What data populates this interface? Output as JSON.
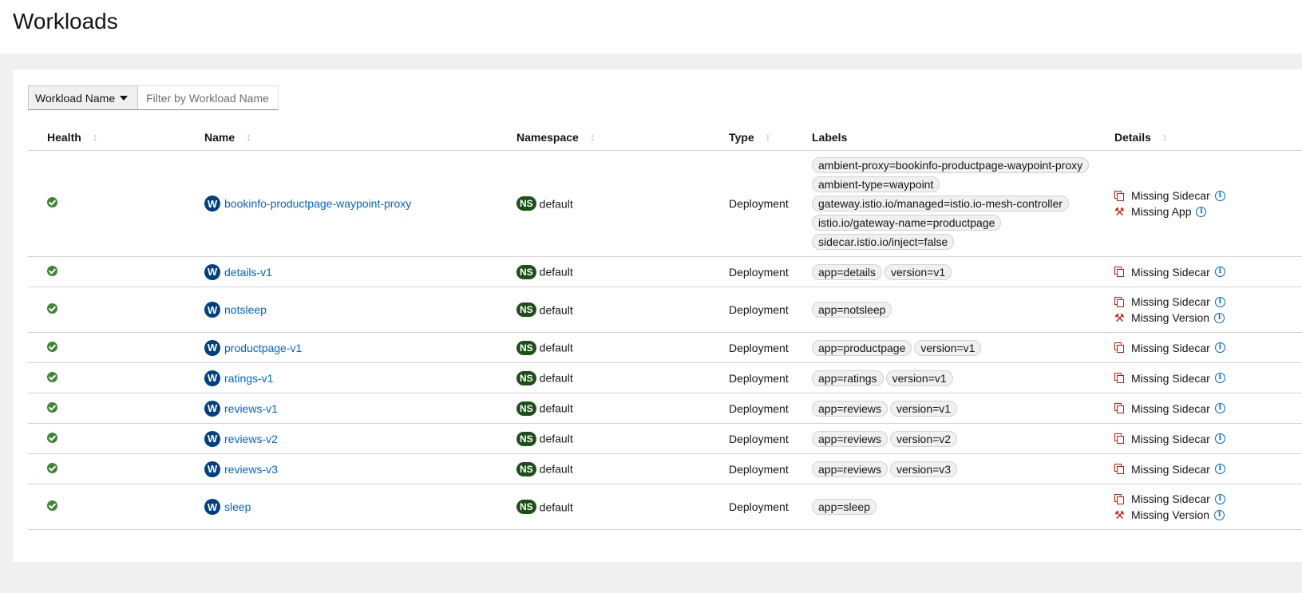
{
  "page": {
    "title": "Workloads"
  },
  "filter": {
    "select_label": "Workload Name",
    "placeholder": "Filter by Workload Name"
  },
  "columns": {
    "health": "Health",
    "name": "Name",
    "namespace": "Namespace",
    "type": "Type",
    "labels": "Labels",
    "details": "Details"
  },
  "colors": {
    "link": "#0066cc",
    "health_ok": "#3e8635",
    "workload_badge": "#004080",
    "namespace_badge": "#1e4f18",
    "warning": "#c9190b"
  },
  "badges": {
    "workload": "W",
    "namespace": "NS"
  },
  "rows": [
    {
      "health": "healthy",
      "name": "bookinfo-productpage-waypoint-proxy",
      "namespace": "default",
      "type": "Deployment",
      "labels": [
        "ambient-proxy=bookinfo-productpage-waypoint-proxy",
        "ambient-type=waypoint",
        "gateway.istio.io/managed=istio.io-mesh-controller",
        "istio.io/gateway-name=productpage",
        "sidecar.istio.io/inject=false"
      ],
      "details": [
        {
          "icon": "sidecar-icon",
          "text": "Missing Sidecar"
        },
        {
          "icon": "wrench-icon",
          "text": "Missing App"
        }
      ]
    },
    {
      "health": "healthy",
      "name": "details-v1",
      "namespace": "default",
      "type": "Deployment",
      "labels": [
        "app=details",
        "version=v1"
      ],
      "details": [
        {
          "icon": "sidecar-icon",
          "text": "Missing Sidecar"
        }
      ]
    },
    {
      "health": "healthy",
      "name": "notsleep",
      "namespace": "default",
      "type": "Deployment",
      "labels": [
        "app=notsleep"
      ],
      "details": [
        {
          "icon": "sidecar-icon",
          "text": "Missing Sidecar"
        },
        {
          "icon": "wrench-icon",
          "text": "Missing Version"
        }
      ]
    },
    {
      "health": "healthy",
      "name": "productpage-v1",
      "namespace": "default",
      "type": "Deployment",
      "labels": [
        "app=productpage",
        "version=v1"
      ],
      "details": [
        {
          "icon": "sidecar-icon",
          "text": "Missing Sidecar"
        }
      ]
    },
    {
      "health": "healthy",
      "name": "ratings-v1",
      "namespace": "default",
      "type": "Deployment",
      "labels": [
        "app=ratings",
        "version=v1"
      ],
      "details": [
        {
          "icon": "sidecar-icon",
          "text": "Missing Sidecar"
        }
      ]
    },
    {
      "health": "healthy",
      "name": "reviews-v1",
      "namespace": "default",
      "type": "Deployment",
      "labels": [
        "app=reviews",
        "version=v1"
      ],
      "details": [
        {
          "icon": "sidecar-icon",
          "text": "Missing Sidecar"
        }
      ]
    },
    {
      "health": "healthy",
      "name": "reviews-v2",
      "namespace": "default",
      "type": "Deployment",
      "labels": [
        "app=reviews",
        "version=v2"
      ],
      "details": [
        {
          "icon": "sidecar-icon",
          "text": "Missing Sidecar"
        }
      ]
    },
    {
      "health": "healthy",
      "name": "reviews-v3",
      "namespace": "default",
      "type": "Deployment",
      "labels": [
        "app=reviews",
        "version=v3"
      ],
      "details": [
        {
          "icon": "sidecar-icon",
          "text": "Missing Sidecar"
        }
      ]
    },
    {
      "health": "healthy",
      "name": "sleep",
      "namespace": "default",
      "type": "Deployment",
      "labels": [
        "app=sleep"
      ],
      "details": [
        {
          "icon": "sidecar-icon",
          "text": "Missing Sidecar"
        },
        {
          "icon": "wrench-icon",
          "text": "Missing Version"
        }
      ]
    }
  ]
}
